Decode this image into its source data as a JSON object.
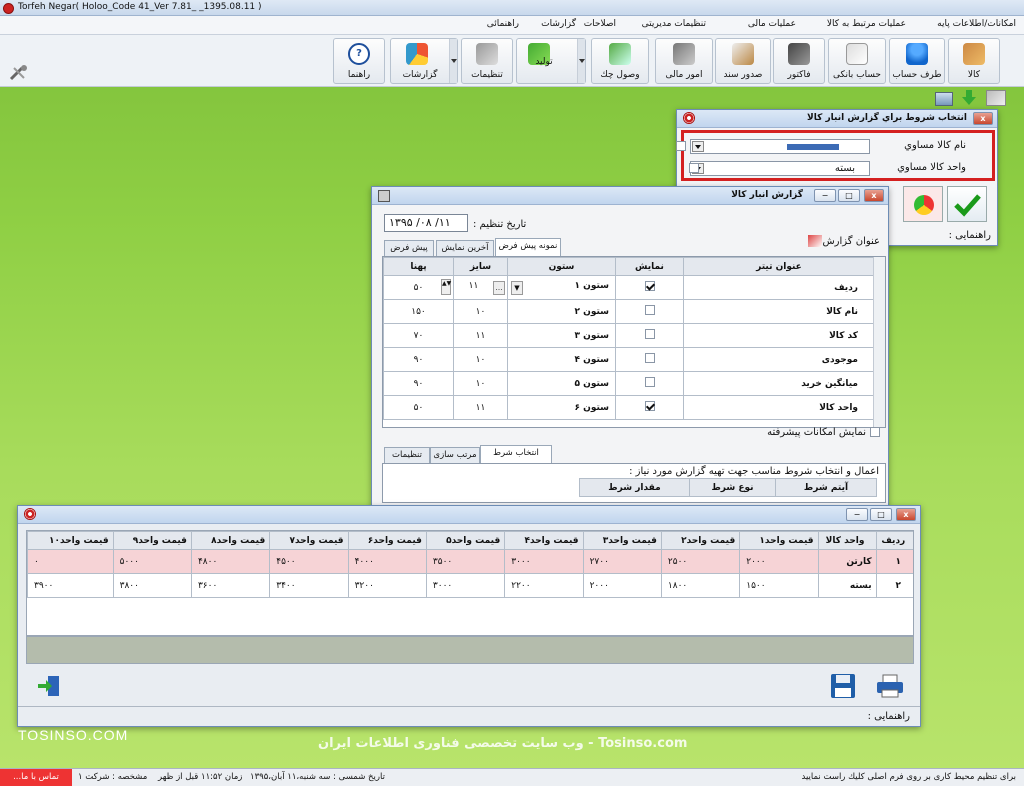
{
  "app_title": "Torfeh Negar( Holoo_Code 41_Ver 7.81_             _1395.08.11 )",
  "menu": [
    "امکانات/اطلاعات پایه",
    "عملیات مرتبط به کالا",
    "عملیات مالی",
    "تنظیمات مدیریتی",
    "اصلاحات",
    "گزارشات",
    "راهنمائی"
  ],
  "toolbar": {
    "kala": "کالا",
    "taraf": "طرف حساب",
    "bank": "حساب بانکی",
    "factor": "فاکتور",
    "sanad": "صدور سند",
    "mali": "امور مالی",
    "chek": "وصول چك",
    "tolid": "تولید",
    "tanzimat": "تنظیمات",
    "gozareshat": "گزارشات",
    "rahnama": "راهنما"
  },
  "cond": {
    "title": "انتخاب شروط براي گزارش انبار كالا",
    "row1_label": "نام كالا مساوي",
    "row2_label": "واحد كالا مساوي",
    "row2_value": "بسته",
    "help": "راهنمایی :"
  },
  "report": {
    "title": "گزارش انبار كالا",
    "date_label": "تاریخ تنظیم :",
    "date_value": "۱۳۹۵ /۰۸ /۱۱",
    "report_title_label": "عنوان گزارش",
    "tabs": [
      "نمونه پیش فرض",
      "آخرین نمایش",
      "پیش فرض"
    ],
    "columns": [
      "عنوان تیتر",
      "نمایش",
      "ستون",
      "سایز",
      "پهنا"
    ],
    "rows": [
      {
        "title": "ردیف",
        "show": true,
        "col": "ستون ۱",
        "size": "۱۱",
        "width": "۵۰"
      },
      {
        "title": "نام كالا",
        "show": false,
        "col": "ستون ۲",
        "size": "۱۰",
        "width": "۱۵۰"
      },
      {
        "title": "كد كالا",
        "show": false,
        "col": "ستون ۳",
        "size": "۱۱",
        "width": "۷۰"
      },
      {
        "title": "موجودی",
        "show": false,
        "col": "ستون ۴",
        "size": "۱۰",
        "width": "۹۰"
      },
      {
        "title": "میانگین خرید",
        "show": false,
        "col": "ستون ۵",
        "size": "۱۰",
        "width": "۹۰"
      },
      {
        "title": "واحد كالا",
        "show": true,
        "col": "ستون ۶",
        "size": "۱۱",
        "width": "۵۰"
      }
    ],
    "advanced": "نمایش امكانات پیشرفته",
    "tabs2": [
      "انتخاب شرط",
      "مرتب سازی",
      "تنظیمات"
    ],
    "cond_hint": "اعمال و انتخاب شروط مناسب جهت تهیه گزارش  مورد نیاز :",
    "cond_cols": [
      "آیتم شرط",
      "نوع شرط",
      "مقدار شرط"
    ]
  },
  "result": {
    "headers": [
      "ردیف",
      "واحد كالا",
      "قیمت واحد۱",
      "قیمت واحد۲",
      "قیمت واحد۳",
      "قیمت واحد۴",
      "قیمت واحد۵",
      "قیمت واحد۶",
      "قیمت واحد۷",
      "قیمت واحد۸",
      "قیمت واحد۹",
      "قیمت واحد۱۰"
    ],
    "rows": [
      [
        "۱",
        "كارتن",
        "۲۰۰۰",
        "۲۵۰۰",
        "۲۷۰۰",
        "۳۰۰۰",
        "۳۵۰۰",
        "۴۰۰۰",
        "۴۵۰۰",
        "۴۸۰۰",
        "۵۰۰۰",
        "۰"
      ],
      [
        "۲",
        "بسته",
        "۱۵۰۰",
        "۱۸۰۰",
        "۲۰۰۰",
        "۲۲۰۰",
        "۳۰۰۰",
        "۳۲۰۰",
        "۳۴۰۰",
        "۳۶۰۰",
        "۳۸۰۰",
        "۳۹۰۰"
      ]
    ],
    "help": "راهنمایی :"
  },
  "watermark": {
    "left": "TOSINSO.COM",
    "center": "Tosinso.com - وب سایت تخصصی فناوری اطلاعات ایران"
  },
  "status": {
    "hint": "برای تنظیم محیط كاری بر روی فرم اصلی كلیك راست نمایید",
    "date": "تاریخ شمسی : سه شنبه،۱۱ آبان،۱۳۹۵",
    "time": "زمان ۱۱:۵۲ قبل از ظهر",
    "company": "مشخصه : شركت ۱",
    "contact": "تماس با ما..."
  },
  "colors": {
    "desktop": "#8fcf44",
    "highlight_row": "#f6d3d6",
    "cond_border": "#d42020"
  }
}
